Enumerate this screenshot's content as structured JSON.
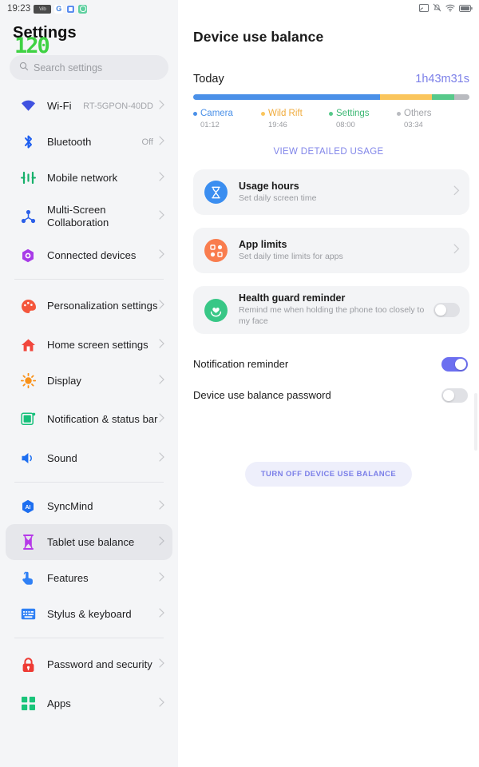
{
  "status_bar": {
    "time": "19:23",
    "left_icons": [
      {
        "name": "vibrate-badge-icon",
        "label": "Vib"
      },
      {
        "name": "google-app-icon",
        "label": "G"
      },
      {
        "name": "docs-app-icon",
        "label": ""
      },
      {
        "name": "whatsapp-app-icon",
        "label": ""
      }
    ],
    "right_icons": [
      {
        "name": "screencast-icon"
      },
      {
        "name": "notifications-muted-icon"
      },
      {
        "name": "wifi-icon"
      },
      {
        "name": "battery-icon"
      }
    ]
  },
  "fps_overlay": "120",
  "sidebar": {
    "title": "Settings",
    "search": {
      "placeholder": "Search settings"
    },
    "groups": [
      {
        "items": [
          {
            "label": "Wi-Fi",
            "value": "RT-5GPON-40DD",
            "icon": "wifi-icon",
            "selected": false
          },
          {
            "label": "Bluetooth",
            "value": "Off",
            "icon": "bluetooth-icon",
            "selected": false
          },
          {
            "label": "Mobile network",
            "value": "",
            "icon": "mobile-network-icon",
            "selected": false
          },
          {
            "label": "Multi-Screen Collaboration",
            "value": "",
            "icon": "multi-screen-icon",
            "selected": false
          },
          {
            "label": "Connected devices",
            "value": "",
            "icon": "connected-devices-icon",
            "selected": false
          }
        ]
      },
      {
        "items": [
          {
            "label": "Personalization settings",
            "value": "",
            "icon": "palette-icon",
            "selected": false
          },
          {
            "label": "Home screen settings",
            "value": "",
            "icon": "home-icon",
            "selected": false
          },
          {
            "label": "Display",
            "value": "",
            "icon": "brightness-icon",
            "selected": false
          },
          {
            "label": "Notification & status bar",
            "value": "",
            "icon": "notification-bar-icon",
            "selected": false
          },
          {
            "label": "Sound",
            "value": "",
            "icon": "speaker-icon",
            "selected": false
          }
        ]
      },
      {
        "items": [
          {
            "label": "SyncMind",
            "value": "",
            "icon": "syncmind-ai-icon",
            "selected": false
          },
          {
            "label": "Tablet use balance",
            "value": "",
            "icon": "hourglass-icon",
            "selected": true
          },
          {
            "label": "Features",
            "value": "",
            "icon": "touch-gesture-icon",
            "selected": false
          },
          {
            "label": "Stylus & keyboard",
            "value": "",
            "icon": "keyboard-icon",
            "selected": false
          }
        ]
      },
      {
        "items": [
          {
            "label": "Password and security",
            "value": "",
            "icon": "lock-icon",
            "selected": false
          },
          {
            "label": "Apps",
            "value": "",
            "icon": "apps-grid-icon",
            "selected": false
          }
        ]
      }
    ]
  },
  "main": {
    "title": "Device use balance",
    "today_label": "Today",
    "today_total": "1h43m31s",
    "view_detailed_usage": "VIEW DETAILED USAGE",
    "cards": [
      {
        "title": "Usage hours",
        "subtitle": "Set daily screen time",
        "icon": "hourglass-icon",
        "icon_bg": "#3b8ef0",
        "has_chevron": true,
        "has_switch": false
      },
      {
        "title": "App limits",
        "subtitle": "Set daily time limits for apps",
        "icon": "app-limits-icon",
        "icon_bg": "#f97d4e",
        "has_chevron": true,
        "has_switch": false
      },
      {
        "title": "Health guard reminder",
        "subtitle": "Remind me when holding the phone too closely to my face",
        "icon": "health-guard-icon",
        "icon_bg": "#38c786",
        "has_chevron": false,
        "has_switch": true,
        "switch_on": false
      }
    ],
    "toggles": [
      {
        "label": "Notification reminder",
        "on": true
      },
      {
        "label": "Device use balance password",
        "on": false
      }
    ],
    "turn_off_button": "TURN OFF DEVICE USE BALANCE"
  },
  "chart_data": {
    "type": "bar",
    "title": "Today",
    "subtitle": "1h43m31s",
    "categories": [
      "Camera",
      "Wild Rift",
      "Settings",
      "Others"
    ],
    "values": [
      1.2,
      19.77,
      8.0,
      3.57
    ],
    "value_labels": [
      "01:12",
      "19:46",
      "08:00",
      "03:34"
    ],
    "colors": [
      "#4a90e8",
      "#fac55c",
      "#57c98a",
      "#b9bbc0"
    ],
    "segment_percent": [
      67.5,
      19.0,
      8.0,
      5.5
    ],
    "xlabel": "",
    "ylabel": "",
    "legend_position": "bottom",
    "grid": false
  }
}
